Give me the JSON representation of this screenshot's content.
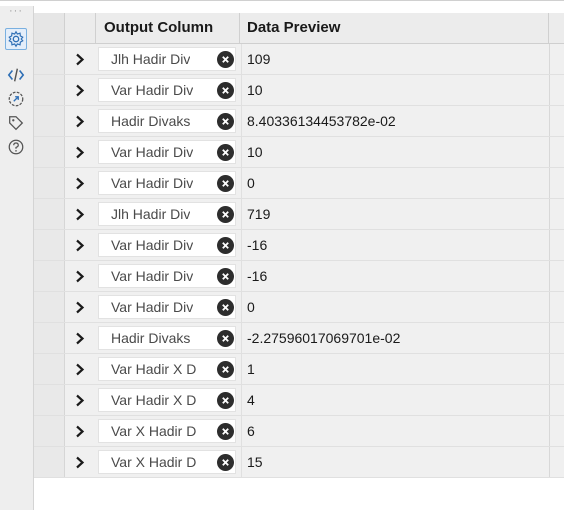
{
  "header": {
    "output_column": "Output Column",
    "data_preview": "Data Preview"
  },
  "sidebar": {
    "items": [
      {
        "icon": "gear-icon",
        "active": true
      },
      {
        "icon": "code-icon",
        "active": false
      },
      {
        "icon": "share-arrow-icon",
        "active": false
      },
      {
        "icon": "tag-icon",
        "active": false
      },
      {
        "icon": "help-icon",
        "active": false
      }
    ]
  },
  "rows": [
    {
      "name": "Jlh Hadir Div",
      "value": "109"
    },
    {
      "name": "Var Hadir Div",
      "value": "10"
    },
    {
      "name": "Hadir Divaks",
      "value": "8.40336134453782e-02"
    },
    {
      "name": "Var Hadir Div",
      "value": "10"
    },
    {
      "name": "Var Hadir Div",
      "value": "0"
    },
    {
      "name": "Jlh Hadir Div",
      "value": "719"
    },
    {
      "name": "Var Hadir Div",
      "value": "-16"
    },
    {
      "name": "Var Hadir Div",
      "value": "-16"
    },
    {
      "name": "Var Hadir Div",
      "value": "0"
    },
    {
      "name": "Hadir Divaks",
      "value": "-2.27596017069701e-02"
    },
    {
      "name": "Var Hadir X D",
      "value": "1"
    },
    {
      "name": "Var Hadir X D",
      "value": "4"
    },
    {
      "name": "Var X Hadir D",
      "value": "6"
    },
    {
      "name": "Var X Hadir D",
      "value": "15"
    }
  ],
  "colors": {
    "accent": "#7ab0e0",
    "icon_blue": "#2f6fb5",
    "icon_gray": "#555555"
  }
}
